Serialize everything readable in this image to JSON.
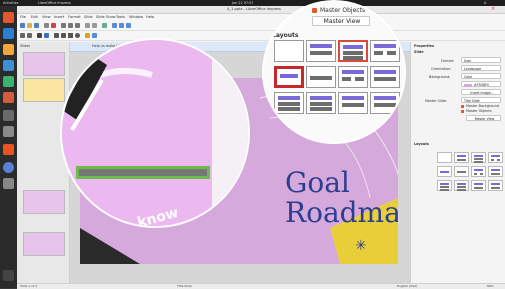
{
  "topbar": {
    "activities": "Activities",
    "app": "LibreOffice Impress",
    "clock": "Jan 22  07:57",
    "lang": "A"
  },
  "window": {
    "title": "4_1.pptx - LibreOffice Impress"
  },
  "menu": [
    "File",
    "Edit",
    "View",
    "Insert",
    "Format",
    "Slide",
    "Slide Show",
    "Tools",
    "Window",
    "Help"
  ],
  "slides_panel": {
    "title": "Slides"
  },
  "info_bar": {
    "text": "Help us make LibreOffice even better!"
  },
  "slide": {
    "title_line1": "Goal",
    "title_line2": "Roadmap",
    "decor_text": "know"
  },
  "sidebar": {
    "properties_title": "Properties",
    "slide_section": "Slide",
    "format_label": "Format:",
    "format_value": "User",
    "orientation_label": "Orientation:",
    "orientation_value": "Landscape",
    "background_label": "Background:",
    "background_value": "Color",
    "color_value": "#F5D8F0",
    "insert_image": "Insert Image...",
    "master_slide_label": "Master Slide:",
    "master_slide_value": "Title Slide",
    "master_background": "Master Background",
    "master_objects": "Master Objects",
    "master_view": "Master View",
    "layouts_title": "Layouts"
  },
  "magnifier": {
    "master_objects": "Master Objects",
    "master_view": "Master View",
    "layouts_title": "Layouts"
  },
  "statusbar": {
    "slide_info": "Slide 1 of 4",
    "mode": "Title Slide",
    "selection": "English (USA)",
    "zoom": "80%"
  }
}
